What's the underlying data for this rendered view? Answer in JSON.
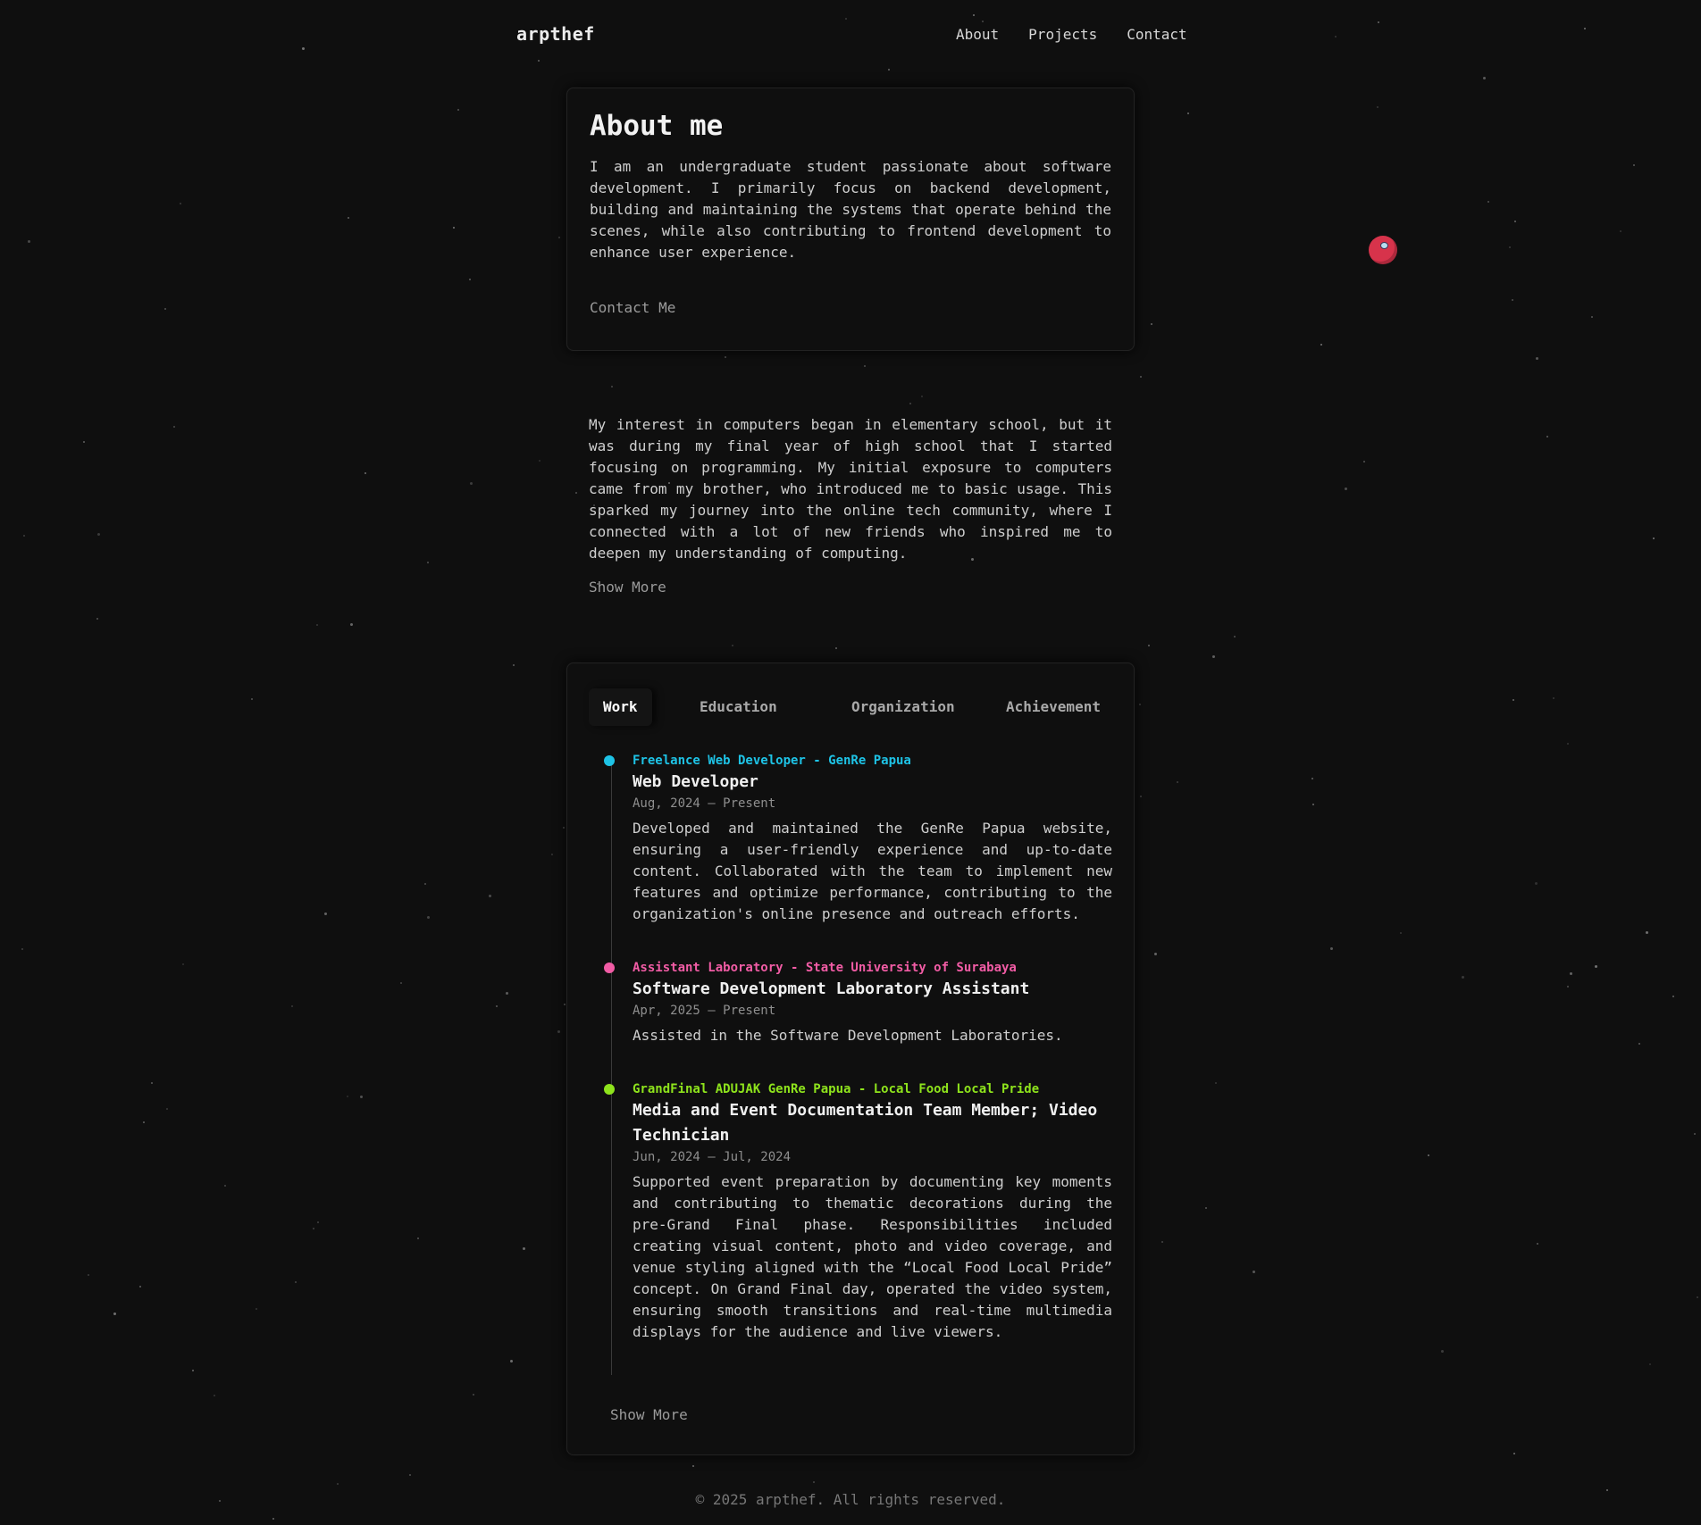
{
  "header": {
    "brand": "arpthef",
    "nav": [
      "About",
      "Projects",
      "Contact"
    ]
  },
  "about": {
    "title": "About me",
    "intro": "I am an undergraduate student passionate about software development. I primarily focus on backend development, building and maintaining the systems that operate behind the scenes, while also contributing to frontend development to enhance user experience.",
    "contact_label": "Contact Me"
  },
  "story": {
    "text": "My interest in computers began in elementary school, but it was during my final year of high school that I started focusing on programming. My initial exposure to computers came from my brother, who introduced me to basic usage. This sparked my journey into the online tech community, where I connected with a lot of new friends who inspired me to deepen my understanding of computing.",
    "show_more_label": "Show More"
  },
  "experience": {
    "tabs": [
      "Work",
      "Education",
      "Organization",
      "Achievement"
    ],
    "active_tab": "Work",
    "entries": [
      {
        "org": "Freelance Web Developer - GenRe Papua",
        "role": "Web Developer",
        "date": "Aug, 2024 – Present",
        "description": "Developed and maintained the GenRe Papua website, ensuring a user-friendly experience and up-to-date content. Collaborated with the team to implement new features and optimize performance, contributing to the organization's online presence and outreach efforts.",
        "color": "#1ec3e6"
      },
      {
        "org": "Assistant Laboratory - State University of Surabaya",
        "role": "Software Development Laboratory Assistant",
        "date": "Apr, 2025 – Present",
        "description": "Assisted in the Software Development Laboratories.",
        "color": "#f15ca5"
      },
      {
        "org": "GrandFinal ADUJAK GenRe Papua - Local Food Local Pride",
        "role": "Media and Event Documentation Team Member; Video Technician",
        "date": "Jun, 2024 – Jul, 2024",
        "description": "Supported event preparation by documenting key moments and contributing to thematic decorations during the pre-Grand Final phase. Responsibilities included creating visual content, photo and video coverage, and venue styling aligned with the “Local Food Local Pride” concept. On Grand Final day, operated the video system, ensuring smooth transitions and real-time multimedia displays for the audience and live viewers.",
        "color": "#8ee31c"
      }
    ],
    "show_more_label": "Show More"
  },
  "footer": {
    "text": "© 2025 arpthef. All rights reserved."
  },
  "colors": {
    "background": "#0f0f0f",
    "accent_cyan": "#1ec3e6",
    "accent_pink": "#f15ca5",
    "accent_green": "#8ee31c",
    "orb": "#d7334b"
  },
  "icons": [
    "orb-mascot-icon",
    "timeline-dot-icon"
  ]
}
